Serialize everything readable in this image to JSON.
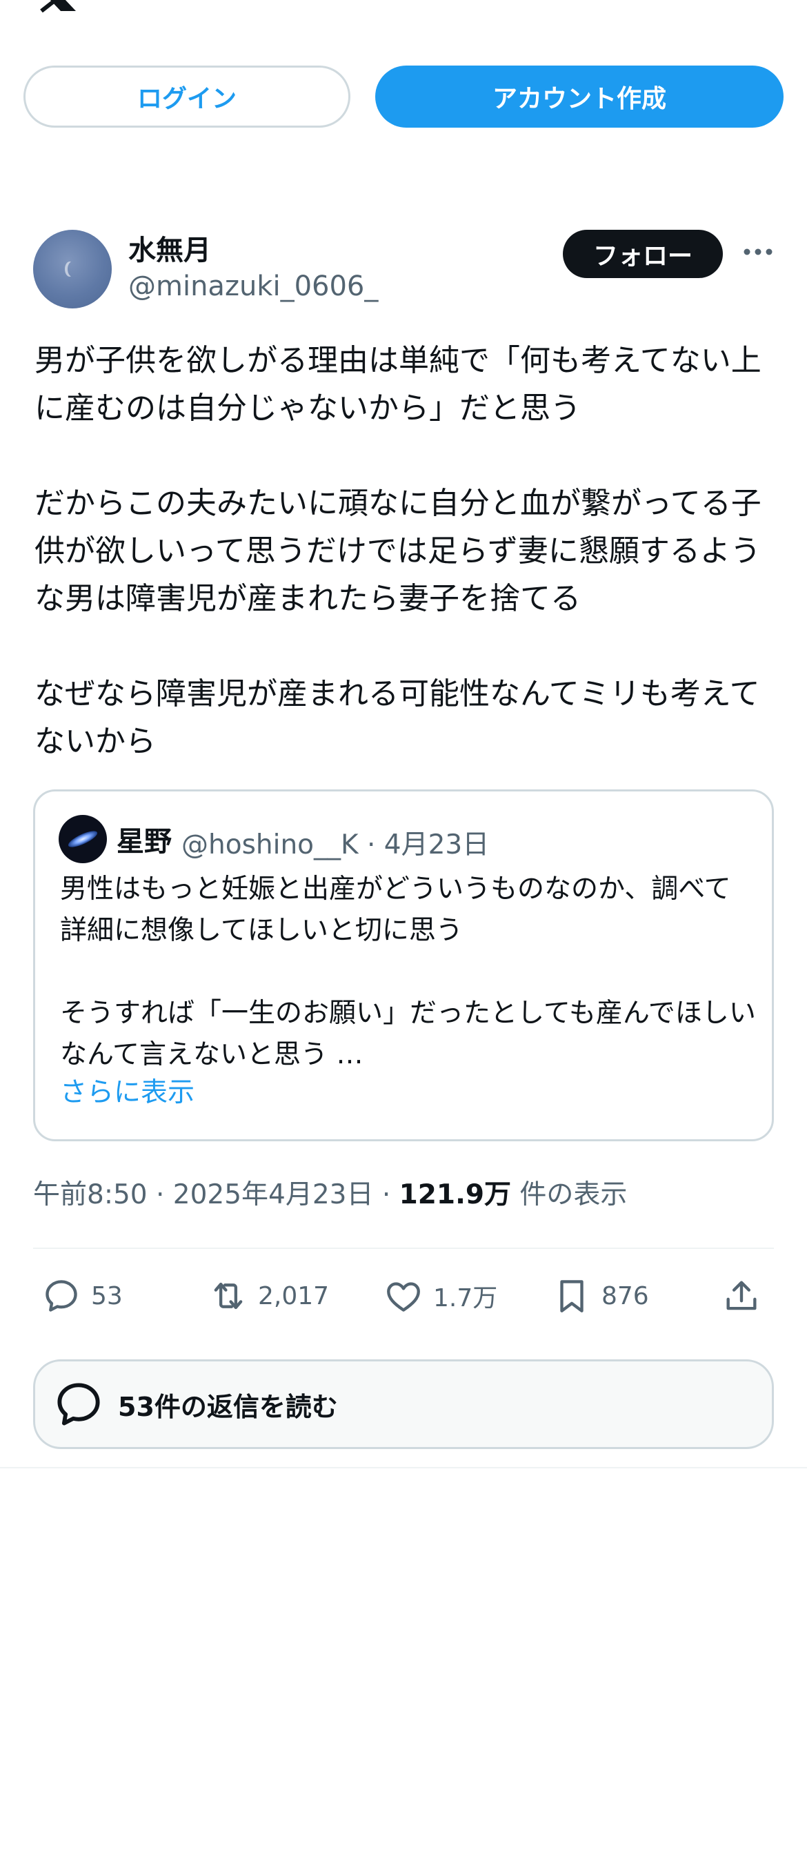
{
  "header": {
    "logo_icon": "x-logo-icon",
    "login_label": "ログイン",
    "signup_label": "アカウント作成"
  },
  "tweet": {
    "author_name": "水無月",
    "author_handle": "@minazuki_0606_",
    "follow_label": "フォロー",
    "text": "男が子供を欲しがる理由は単純で「何も考えてない上に産むのは自分じゃないから」だと思う\n\nだからこの夫みたいに頑なに自分と血が繋がってる子供が欲しいって思うだけでは足らず妻に懇願するような男は障害児が産まれたら妻子を捨てる\n\nなぜなら障害児が産まれる可能性なんてミリも考えてないから",
    "timestamp": "午前8:50 · 2025年4月23日 · ",
    "views_count": "121.9万",
    "views_suffix": " 件の表示"
  },
  "quote": {
    "author_name": "星野",
    "meta": "@hoshino__K · 4月23日",
    "text": "男性はもっと妊娠と出産がどういうものなのか、調べて詳細に想像してほしいと切に思う\n\nそうすれば「一生のお願い」だったとしても産んでほしいなんて言えないと思う …",
    "show_more_label": "さらに表示"
  },
  "actions": {
    "reply_count": "53",
    "retweet_count": "2,017",
    "like_count": "1.7万",
    "bookmark_count": "876"
  },
  "replies_button_label": "53件の返信を読む",
  "colors": {
    "accent": "#1d9bf0",
    "text_primary": "#0f1419",
    "text_secondary": "#536471",
    "border": "#cfd9de"
  }
}
